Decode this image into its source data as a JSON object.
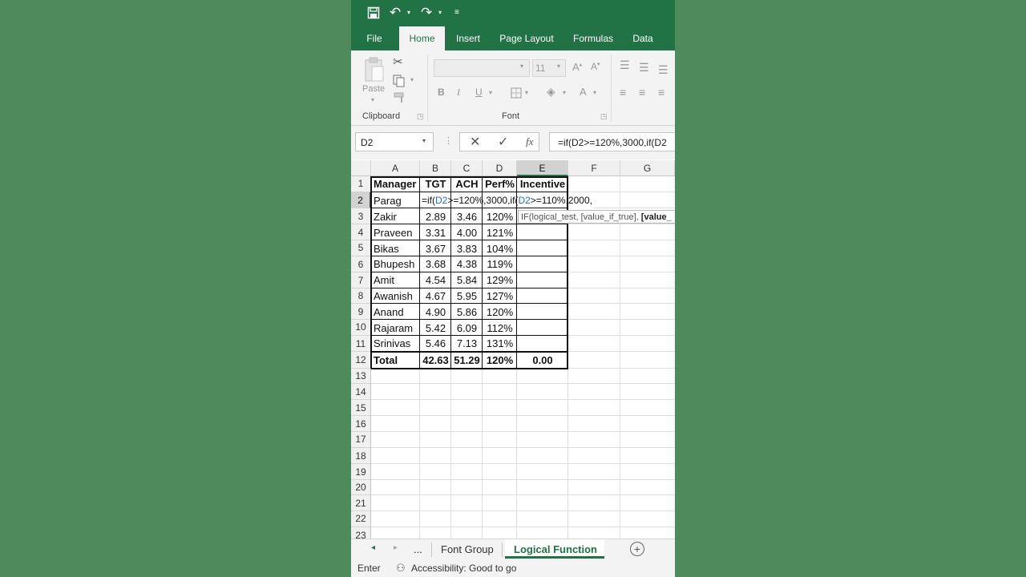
{
  "ribbon_tabs": [
    "File",
    "Home",
    "Insert",
    "Page Layout",
    "Formulas",
    "Data"
  ],
  "clipboard": {
    "paste_label": "Paste",
    "group_label": "Clipboard"
  },
  "font_group": {
    "size": "11",
    "group_label": "Font"
  },
  "namebox": "D2",
  "formula_bar": "=if(D2>=120%,3000,if(D2",
  "columns": [
    "A",
    "B",
    "C",
    "D",
    "E",
    "F",
    "G"
  ],
  "rows": [
    "1",
    "2",
    "3",
    "4",
    "5",
    "6",
    "7",
    "8",
    "9",
    "10",
    "11",
    "12",
    "13",
    "14",
    "15",
    "16",
    "17",
    "18",
    "19",
    "20",
    "21",
    "22",
    "23"
  ],
  "header": [
    "Manager",
    "TGT",
    "ACH",
    "Perf%",
    "Incentive"
  ],
  "editing": {
    "manager": "Parag",
    "formula": "=if(D2>=120%,3000,if(D2>=110%,2000,"
  },
  "data_rows": [
    [
      "Zakir",
      "2.89",
      "3.46",
      "120%"
    ],
    [
      "Praveen",
      "3.31",
      "4.00",
      "121%"
    ],
    [
      "Bikas",
      "3.67",
      "3.83",
      "104%"
    ],
    [
      "Bhupesh",
      "3.68",
      "4.38",
      "119%"
    ],
    [
      "Amit",
      "4.54",
      "5.84",
      "129%"
    ],
    [
      "Awanish",
      "4.67",
      "5.95",
      "127%"
    ],
    [
      "Anand",
      "4.90",
      "5.86",
      "120%"
    ],
    [
      "Rajaram",
      "5.42",
      "6.09",
      "112%"
    ],
    [
      "Srinivas",
      "5.46",
      "7.13",
      "131%"
    ]
  ],
  "total": [
    "Total",
    "42.63",
    "51.29",
    "120%",
    "0.00"
  ],
  "tooltip": {
    "text": "IF(logical_test, [value_if_true], ",
    "bold": "[value_"
  },
  "sheets": {
    "ellipsis": "...",
    "tab1": "Font Group",
    "tab2": "Logical Function"
  },
  "status": {
    "mode": "Enter",
    "accessibility": "Accessibility: Good to go"
  },
  "colors": {
    "accent": "#217346",
    "ref_blue": "#2f6fd4"
  }
}
